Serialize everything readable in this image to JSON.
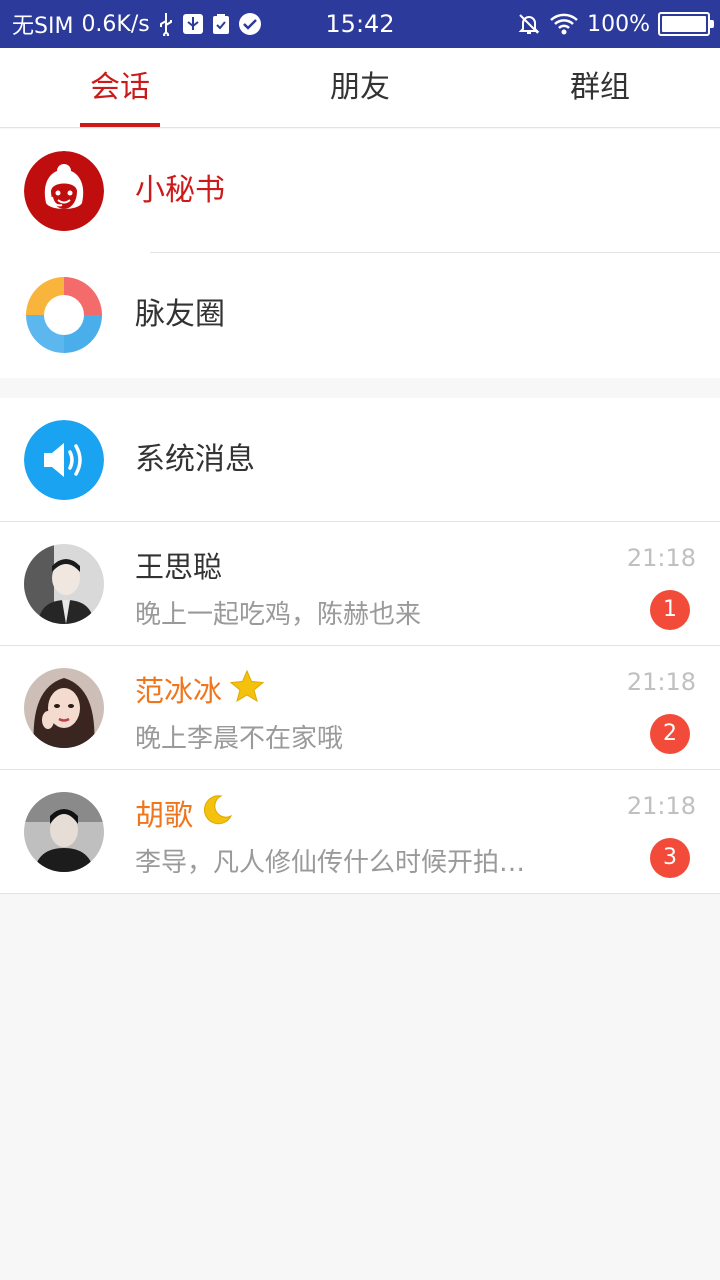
{
  "status_bar": {
    "carrier": "无SIM",
    "speed": "0.6K/s",
    "time": "15:42",
    "battery": "100%",
    "battery_level": 1.0
  },
  "tabs": [
    {
      "label": "会话",
      "active": true
    },
    {
      "label": "朋友",
      "active": false
    },
    {
      "label": "群组",
      "active": false
    }
  ],
  "top_items": [
    {
      "title": "小秘书",
      "icon": "secretary-icon"
    },
    {
      "title": "脉友圈",
      "icon": "moments-circle-icon"
    }
  ],
  "system_item": {
    "title": "系统消息",
    "icon": "speaker-icon"
  },
  "chats": [
    {
      "name": "王思聪",
      "message": "晚上一起吃鸡，陈赫也来",
      "time": "21:18",
      "unread": "1",
      "vip_icon": ""
    },
    {
      "name": "范冰冰",
      "message": "晚上李晨不在家哦",
      "time": "21:18",
      "unread": "2",
      "vip_icon": "star-icon"
    },
    {
      "name": "胡歌",
      "message": "李导，凡人修仙传什么时候开拍…",
      "time": "21:18",
      "unread": "3",
      "vip_icon": "moon-icon"
    }
  ],
  "colors": {
    "status_bar": "#2c3a9c",
    "accent_red": "#cc1a1a",
    "vip_orange": "#f0761d",
    "badge_red": "#f24b3a",
    "system_blue": "#1aa3f0"
  }
}
